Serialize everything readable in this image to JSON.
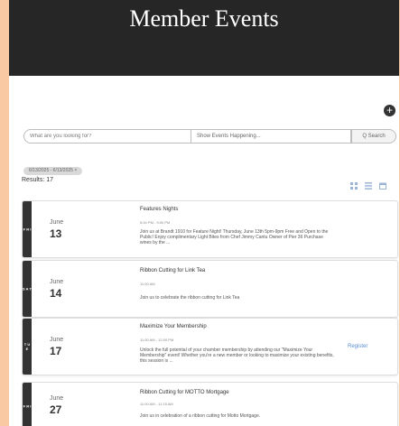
{
  "header": {
    "title": "Member Events"
  },
  "toolbar": {
    "add_label": "+"
  },
  "search": {
    "placeholder": "What are you looking for?",
    "events_value": "Show Events Happening...",
    "button_label": "Q Search"
  },
  "filter": {
    "chip": "6/13/2025 - 6/13/2025 ×"
  },
  "results": {
    "label": "Results: 17"
  },
  "events": [
    {
      "day": "F R I",
      "month": "June",
      "date": "13",
      "title": "Features Nights",
      "time": "5:00 PM - 9:00 PM",
      "description": "Join us at Brandt 1910 for Feature Night! Thursday, June 13th 5pm-9pm Free and Open to the Public! Enjoy complimentary Light Bites from Chef Jimmy Cantu Owner of Pier 36 Purchase wines by the ...",
      "register": ""
    },
    {
      "day": "S A T",
      "month": "June",
      "date": "14",
      "title": "Ribbon Cutting for Link Tea",
      "time": "11:00 AM",
      "description": "Join us to celebrate the ribbon cutting for Link Tea",
      "register": ""
    },
    {
      "day": "T U E",
      "month": "June",
      "date": "17",
      "title": "Maximize Your Membership",
      "time": "11:00 AM - 12:00 PM",
      "description": "Unlock the full potential of your chamber membership by attending our \"Maximize Your Membership\" event! Whether you're a new member or looking to maximize your existing benefits, this session is ...",
      "register": "Register"
    },
    {
      "day": "F R I",
      "month": "June",
      "date": "27",
      "title": "Ribbon Cutting for MOTTO Mortgage",
      "time": "11:00 AM - 11:15 AM",
      "description": "Join us in celebration of a ribbon cutting for Motto Mortgage.",
      "register": ""
    }
  ]
}
